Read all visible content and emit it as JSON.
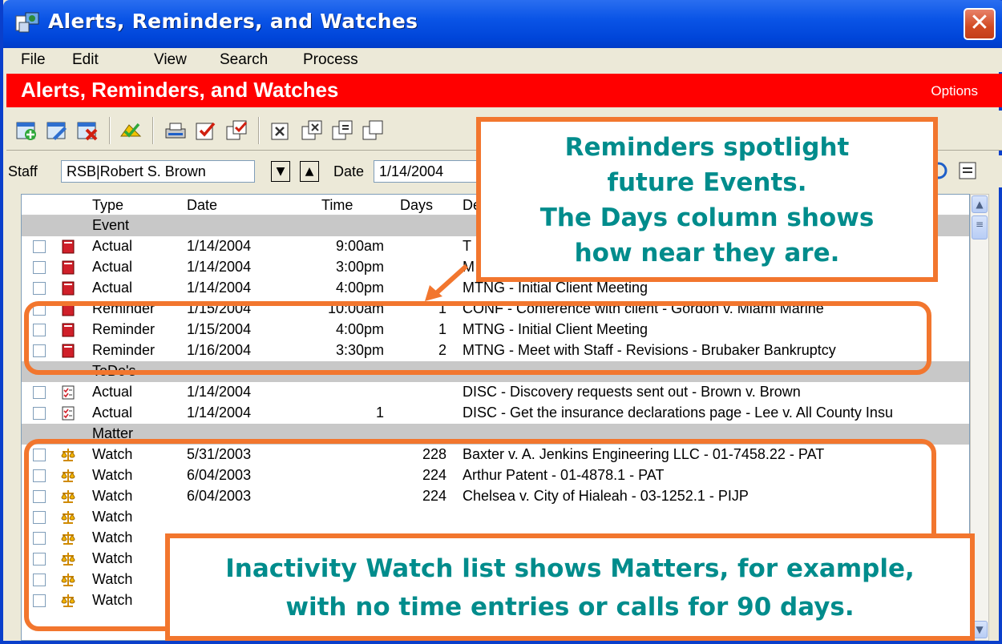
{
  "window": {
    "title": "Alerts, Reminders, and Watches",
    "close_glyph": "✕"
  },
  "menu": [
    "File",
    "Edit",
    "View",
    "Search",
    "Process"
  ],
  "header": {
    "title": "Alerts, Reminders, and Watches",
    "options": "Options"
  },
  "filter": {
    "staff_label": "Staff",
    "staff_value": "RSB|Robert S. Brown",
    "date_label": "Date",
    "date_value": "1/14/2004"
  },
  "columns": [
    "Type",
    "Date",
    "Time",
    "Days",
    "De"
  ],
  "groups": [
    {
      "label": "Event",
      "rows": [
        {
          "type": "Actual",
          "date": "1/14/2004",
          "time": "9:00am",
          "days": "",
          "desc": "T"
        },
        {
          "type": "Actual",
          "date": "1/14/2004",
          "time": "3:00pm",
          "days": "",
          "desc": "M"
        },
        {
          "type": "Actual",
          "date": "1/14/2004",
          "time": "4:00pm",
          "days": "",
          "desc": "MTNG - Initial Client Meeting"
        },
        {
          "type": "Reminder",
          "date": "1/15/2004",
          "time": "10:00am",
          "days": "1",
          "desc": "CONF - Conference with client - Gordon v. Miami Marine"
        },
        {
          "type": "Reminder",
          "date": "1/15/2004",
          "time": "4:00pm",
          "days": "1",
          "desc": "MTNG - Initial Client Meeting"
        },
        {
          "type": "Reminder",
          "date": "1/16/2004",
          "time": "3:30pm",
          "days": "2",
          "desc": "MTNG - Meet with Staff - Revisions - Brubaker Bankruptcy"
        }
      ]
    },
    {
      "label": "ToDo's",
      "rows": [
        {
          "type": "Actual",
          "date": "1/14/2004",
          "time": "",
          "days": "",
          "desc": "DISC - Discovery requests sent out - Brown v. Brown"
        },
        {
          "type": "Actual",
          "date": "1/14/2004",
          "time": "1",
          "days": "",
          "desc": "DISC - Get the insurance declarations page - Lee v. All County Insu"
        }
      ]
    },
    {
      "label": "Matter",
      "rows": [
        {
          "type": "Watch",
          "date": "5/31/2003",
          "time": "",
          "days": "228",
          "desc": "Baxter v. A. Jenkins Engineering LLC - 01-7458.22 - PAT"
        },
        {
          "type": "Watch",
          "date": "6/04/2003",
          "time": "",
          "days": "224",
          "desc": "Arthur Patent - 01-4878.1 - PAT"
        },
        {
          "type": "Watch",
          "date": "6/04/2003",
          "time": "",
          "days": "224",
          "desc": "Chelsea v. City of Hialeah - 03-1252.1 - PIJP"
        },
        {
          "type": "Watch",
          "date": "",
          "time": "",
          "days": "",
          "desc": ""
        },
        {
          "type": "Watch",
          "date": "",
          "time": "",
          "days": "",
          "desc": ""
        },
        {
          "type": "Watch",
          "date": "",
          "time": "",
          "days": "",
          "desc": ""
        },
        {
          "type": "Watch",
          "date": "",
          "time": "",
          "days": "",
          "desc": ""
        },
        {
          "type": "Watch",
          "date": "",
          "time": "",
          "days": "",
          "desc": ""
        }
      ]
    }
  ],
  "callouts": {
    "reminders": [
      "Reminders spotlight",
      "future Events.",
      "The Days column shows",
      "how near they are."
    ],
    "watch": [
      "Inactivity Watch list shows Matters, for example,",
      "with no time entries or calls for 90 days."
    ]
  },
  "colors": {
    "accent_orange": "#F2762E",
    "callout_text": "#008C8C",
    "header_red": "#FF0000"
  }
}
